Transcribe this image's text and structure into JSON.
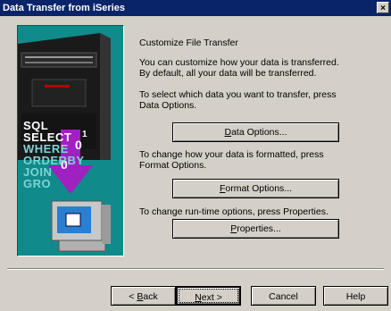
{
  "window": {
    "title": "Data Transfer from iSeries",
    "close_glyph": "×"
  },
  "illustration": {
    "sql_words": [
      "SQL",
      "SELECT",
      "WHERE",
      "ORDERBY",
      "JOIN",
      "GRO"
    ],
    "word_colors": [
      "#ffffff",
      "#ffffff",
      "#7fd4d4",
      "#7fd4d4",
      "#7fd4d4",
      "#7fd4d4"
    ]
  },
  "content": {
    "heading": "Customize File Transfer",
    "intro": "You can customize how your data is transferred.  By default, all your data will be transferred.",
    "data_instruction": "To select which data you want to transfer, press Data Options.",
    "format_instruction": "To change how your data is formatted, press Format Options.",
    "properties_instruction": "To change run-time options, press Properties."
  },
  "buttons": {
    "data_options": {
      "mnemonic": "D",
      "rest": "ata Options..."
    },
    "format_options": {
      "mnemonic": "F",
      "rest": "ormat Options..."
    },
    "properties": {
      "mnemonic": "P",
      "rest": "roperties..."
    }
  },
  "footer": {
    "back": {
      "prefix": "< ",
      "mnemonic": "B",
      "rest": "ack"
    },
    "next": {
      "mnemonic": "N",
      "rest": "ext >"
    },
    "cancel": "Cancel",
    "help": "Help"
  },
  "colors": {
    "titlebar": "#0a246a",
    "dialog_bg": "#d4d0c8",
    "illustration_bg": "#108a8a",
    "arrow": "#a020c0"
  }
}
